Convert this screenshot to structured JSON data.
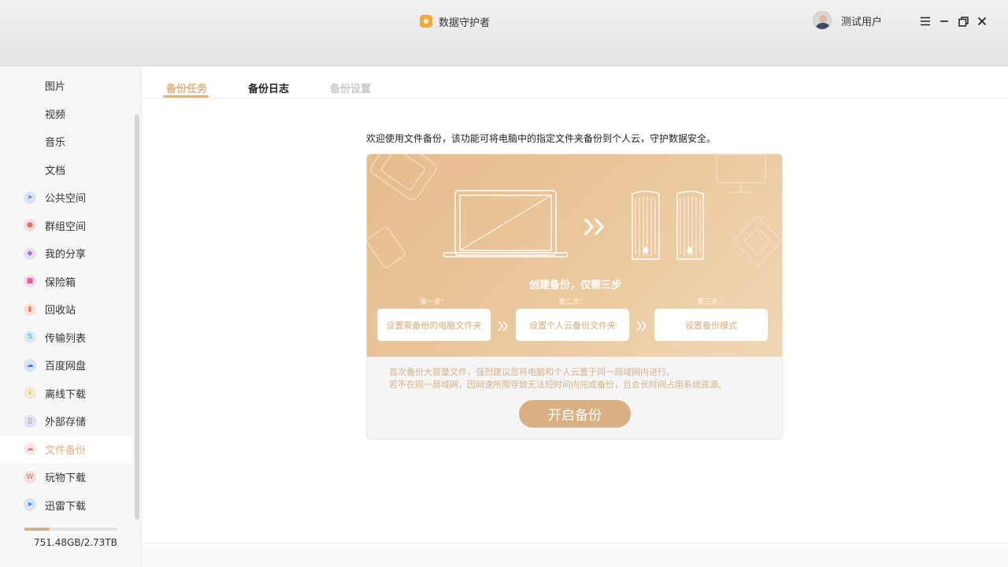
{
  "window": {
    "title": "数据守护者",
    "user_name": "测试用户"
  },
  "sidebar": {
    "items": [
      {
        "label": "图片",
        "icon": "image-icon"
      },
      {
        "label": "视频",
        "icon": "video-icon"
      },
      {
        "label": "音乐",
        "icon": "music-icon"
      },
      {
        "label": "文档",
        "icon": "document-icon"
      },
      {
        "label": "公共空间",
        "icon": "paper-plane-icon",
        "color": "#5b8de8"
      },
      {
        "label": "群组空间",
        "icon": "group-icon",
        "color": "#e96a6a"
      },
      {
        "label": "我的分享",
        "icon": "share-icon",
        "color": "#a06ce0"
      },
      {
        "label": "保险箱",
        "icon": "safe-icon",
        "color": "#e85aa8"
      },
      {
        "label": "回收站",
        "icon": "trash-icon",
        "color": "#f07a55"
      },
      {
        "label": "传输列表",
        "icon": "transfer-icon",
        "color": "#45b3e0"
      },
      {
        "label": "百度网盘",
        "icon": "baidu-cloud-icon",
        "color": "#3a7fe8"
      },
      {
        "label": "离线下载",
        "icon": "download-icon",
        "color": "#f0a53a"
      },
      {
        "label": "外部存储",
        "icon": "external-storage-icon",
        "color": "#8a6ad8"
      },
      {
        "label": "文件备份",
        "icon": "file-backup-icon",
        "color": "#e87a7a"
      },
      {
        "label": "玩物下载",
        "icon": "wanwu-download-icon",
        "color": "#e86a6a"
      },
      {
        "label": "迅雷下载",
        "icon": "thunder-download-icon",
        "color": "#2f7de8"
      }
    ],
    "active_index": 13,
    "storage": {
      "text": "751.48GB/2.73TB",
      "used_fraction": 0.27
    }
  },
  "tabs": [
    {
      "label": "备份任务",
      "state": "active",
      "color": "#e0b27e"
    },
    {
      "label": "备份日志",
      "state": "normal",
      "color": "#222222"
    },
    {
      "label": "备份设置",
      "state": "disabled",
      "color": "#c8c8c8"
    }
  ],
  "main": {
    "welcome": "欢迎使用文件备份，该功能可将电脑中的指定文件夹备份到个人云，守护数据安全。",
    "card": {
      "heading": "创建备份，仅需三步",
      "steps": [
        {
          "label": "第一步：",
          "button": "设置需备份的电脑文件夹"
        },
        {
          "label": "第二步：",
          "button": "设置个人云备份文件夹"
        },
        {
          "label": "第三步：",
          "button": "设置备份模式"
        }
      ],
      "notes": [
        "首次备份大容量文件，强烈建议您将电脑和个人云置于同一局域网内进行。",
        "若不在同一局域网，因网速所限导致无法短时间内完成备份，且会长时间占用系统资源。"
      ],
      "start_button": "开启备份"
    }
  }
}
